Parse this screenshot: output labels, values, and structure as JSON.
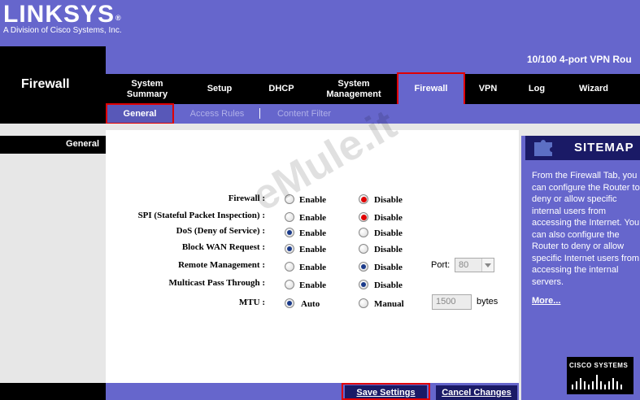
{
  "brand": {
    "logo": "LINKSYS",
    "registered_mark": "®",
    "tagline": "A Division of Cisco Systems, Inc."
  },
  "product": {
    "name": "10/100 4-port VPN Rou"
  },
  "page": {
    "title": "Firewall"
  },
  "nav": {
    "tabs": [
      {
        "label_line1": "System",
        "label_line2": "Summary"
      },
      {
        "label": "Setup"
      },
      {
        "label": "DHCP"
      },
      {
        "label_line1": "System",
        "label_line2": "Management"
      },
      {
        "label": "Firewall"
      },
      {
        "label": "VPN"
      },
      {
        "label": "Log"
      },
      {
        "label": "Wizard"
      }
    ],
    "active": "Firewall"
  },
  "subnav": {
    "tabs": [
      "General",
      "Access Rules",
      "Content Filter"
    ],
    "active": "General"
  },
  "section": {
    "label": "General"
  },
  "settings": {
    "enable_label": "Enable",
    "disable_label": "Disable",
    "rows": [
      {
        "label": "Firewall :",
        "selected": "Disable"
      },
      {
        "label": "SPI (Stateful Packet Inspection) :",
        "selected": "Disable"
      },
      {
        "label": "DoS (Deny of Service) :",
        "selected": "Enable"
      },
      {
        "label": "Block WAN Request :",
        "selected": "Enable"
      },
      {
        "label": "Remote Management :",
        "selected": "Disable"
      },
      {
        "label": "Multicast Pass Through :",
        "selected": "Disable"
      }
    ],
    "port": {
      "label": "Port:",
      "value": "80"
    },
    "mtu": {
      "label": "MTU :",
      "auto_label": "Auto",
      "manual_label": "Manual",
      "selected": "Auto",
      "value": "1500",
      "unit": "bytes"
    }
  },
  "actions": {
    "save": "Save Settings",
    "cancel": "Cancel Changes"
  },
  "sitemap": {
    "title": "SITEMAP",
    "description": "From the Firewall Tab, you can configure the Router to deny or allow specific internal users from accessing the Internet. You can also configure the Router to deny or allow specific Internet users from accessing the internal servers.",
    "more_link": "More...",
    "footer_logo": "CISCO SYSTEMS"
  },
  "watermark": "eMule.it",
  "colors": {
    "brand_purple": "#6666cc",
    "dark_navy": "#1a1a66",
    "highlight_red": "#e00000",
    "radio_red": "#e00000",
    "radio_blue": "#1a3a8a"
  }
}
